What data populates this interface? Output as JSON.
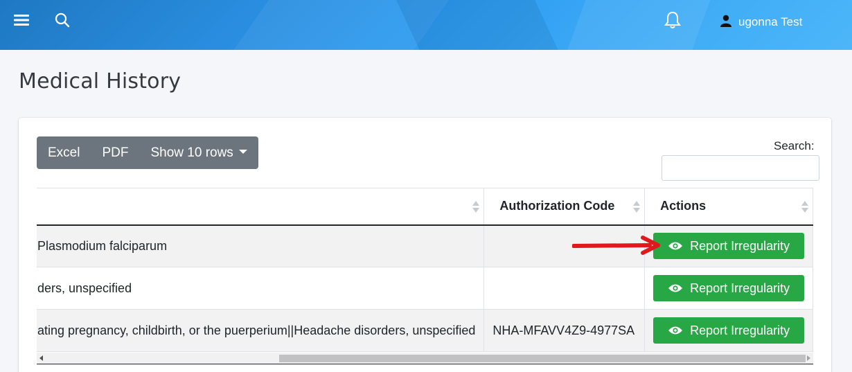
{
  "header": {
    "user_name": "ugonna Test",
    "colors": {
      "gradient_start": "#1f78c2",
      "gradient_end": "#4cb6f8"
    },
    "icons": [
      "hamburger-menu-icon",
      "search-icon",
      "bell-icon",
      "user-icon"
    ]
  },
  "page": {
    "title": "Medical History"
  },
  "toolbar": {
    "excel_label": "Excel",
    "pdf_label": "PDF",
    "rows_label": "Show 10 rows",
    "search_label": "Search:",
    "search_value": ""
  },
  "table": {
    "columns": [
      "",
      "Authorization Code",
      "Actions"
    ],
    "rows": [
      {
        "description": "Plasmodium falciparum",
        "authorization_code": "",
        "action_label": "Report Irregularity"
      },
      {
        "description": "ders, unspecified",
        "authorization_code": "",
        "action_label": "Report Irregularity"
      },
      {
        "description": "ating pregnancy, childbirth, or the puerperium||Headache disorders, unspecified",
        "authorization_code": "NHA-MFAVV4Z9-4977SA",
        "action_label": "Report Irregularity"
      }
    ]
  },
  "colors": {
    "report_button": "#28a745",
    "annotation_arrow": "#e0191f",
    "button_group": "#6c757d"
  }
}
